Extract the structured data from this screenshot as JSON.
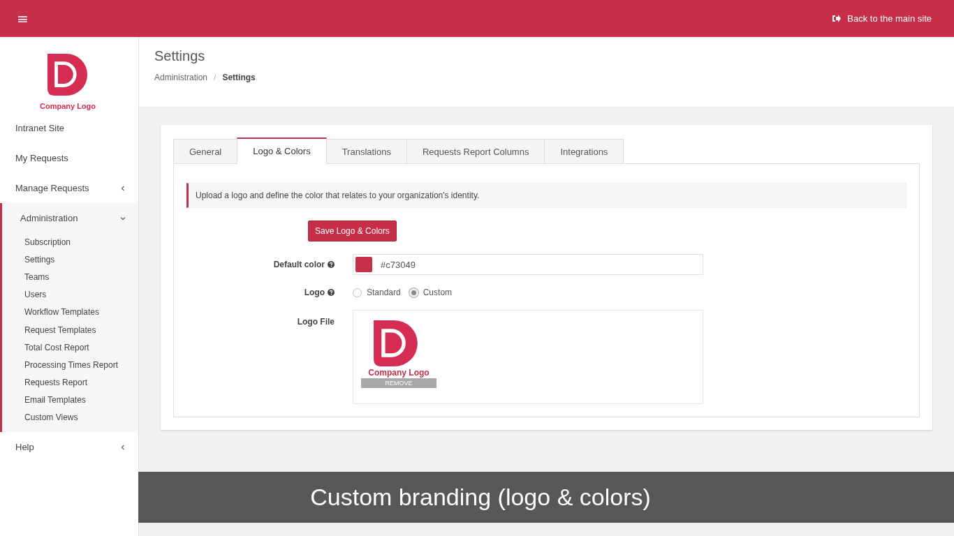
{
  "topbar": {
    "menu_button": "≡",
    "back_link": "Back to the main site"
  },
  "sidebar": {
    "logo_text": "Company Logo",
    "items": [
      {
        "label": "Intranet Site"
      },
      {
        "label": "My Requests"
      },
      {
        "label": "Manage Requests",
        "expanded": false
      },
      {
        "label": "Administration",
        "expanded": true,
        "children": [
          {
            "label": "Subscription"
          },
          {
            "label": "Settings"
          },
          {
            "label": "Teams"
          },
          {
            "label": "Users"
          },
          {
            "label": "Workflow Templates"
          },
          {
            "label": "Request Templates"
          },
          {
            "label": "Total Cost Report"
          },
          {
            "label": "Processing Times Report"
          },
          {
            "label": "Requests Report"
          },
          {
            "label": "Email Templates"
          },
          {
            "label": "Custom Views"
          }
        ]
      },
      {
        "label": "Help",
        "expanded": false
      }
    ]
  },
  "page": {
    "title": "Settings",
    "breadcrumb": [
      "Administration",
      "Settings"
    ],
    "breadcrumb_separator": "/"
  },
  "tabs": [
    {
      "label": "General",
      "selected": false
    },
    {
      "label": "Logo & Colors",
      "selected": true
    },
    {
      "label": "Translations",
      "selected": false
    },
    {
      "label": "Requests Report Columns",
      "selected": false
    },
    {
      "label": "Integrations",
      "selected": false
    }
  ],
  "notice": "Upload a logo and define the color that relates to your organization's identity.",
  "save_button": "Save Logo & Colors",
  "default_color": {
    "label": "Default color",
    "value": "#c73049",
    "color": "#c73049"
  },
  "logo": {
    "label": "Logo",
    "options": [
      {
        "label": "Standard",
        "selected": false
      },
      {
        "label": "Custom",
        "selected": true
      }
    ]
  },
  "logo_file": {
    "label": "Logo File",
    "logo_text": "Company Logo",
    "remove_button": "REMOVE"
  },
  "caption": "Custom branding (logo & colors)"
}
